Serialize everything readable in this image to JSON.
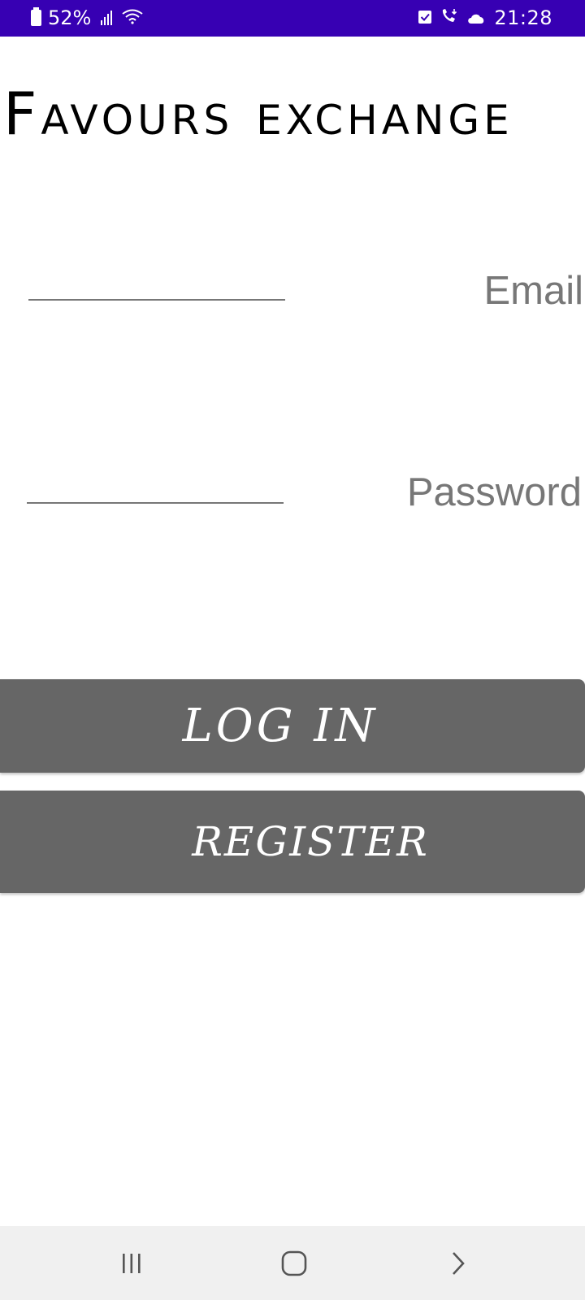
{
  "status_bar": {
    "battery": "52%",
    "time": "21:28",
    "icons": [
      "battery-icon",
      "signal-icon",
      "wifi-icon",
      "checkbox-notification-icon",
      "wifi-call-icon",
      "cloud-icon"
    ]
  },
  "app": {
    "title": "Favours exchange"
  },
  "form": {
    "email_label": "Email",
    "email_value": "",
    "password_label": "Password",
    "password_value": ""
  },
  "buttons": {
    "login_label": "LOG IN",
    "register_label": "REGISTER"
  },
  "colors": {
    "status_bar": "#3700b3",
    "button": "#666666",
    "label": "#777777",
    "nav_bar": "#f0f0f0"
  },
  "nav_bar": {
    "icons": [
      "recent-apps-icon",
      "home-icon",
      "back-icon"
    ]
  }
}
